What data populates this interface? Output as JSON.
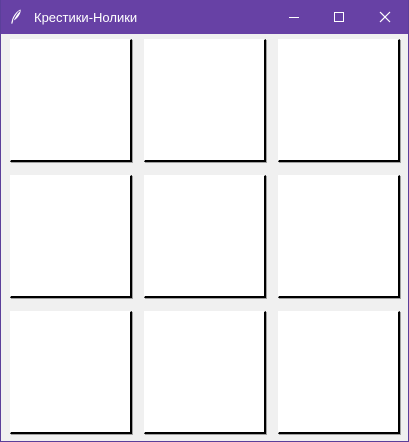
{
  "window": {
    "title": "Крестики-Нолики",
    "icon": "feather-icon",
    "controls": {
      "minimize_icon": "minimize-icon",
      "maximize_icon": "maximize-icon",
      "close_icon": "close-icon"
    },
    "titlebar_color": "#6741a5"
  },
  "board": {
    "cells": [
      {
        "value": ""
      },
      {
        "value": ""
      },
      {
        "value": ""
      },
      {
        "value": ""
      },
      {
        "value": ""
      },
      {
        "value": ""
      },
      {
        "value": ""
      },
      {
        "value": ""
      },
      {
        "value": ""
      }
    ]
  }
}
